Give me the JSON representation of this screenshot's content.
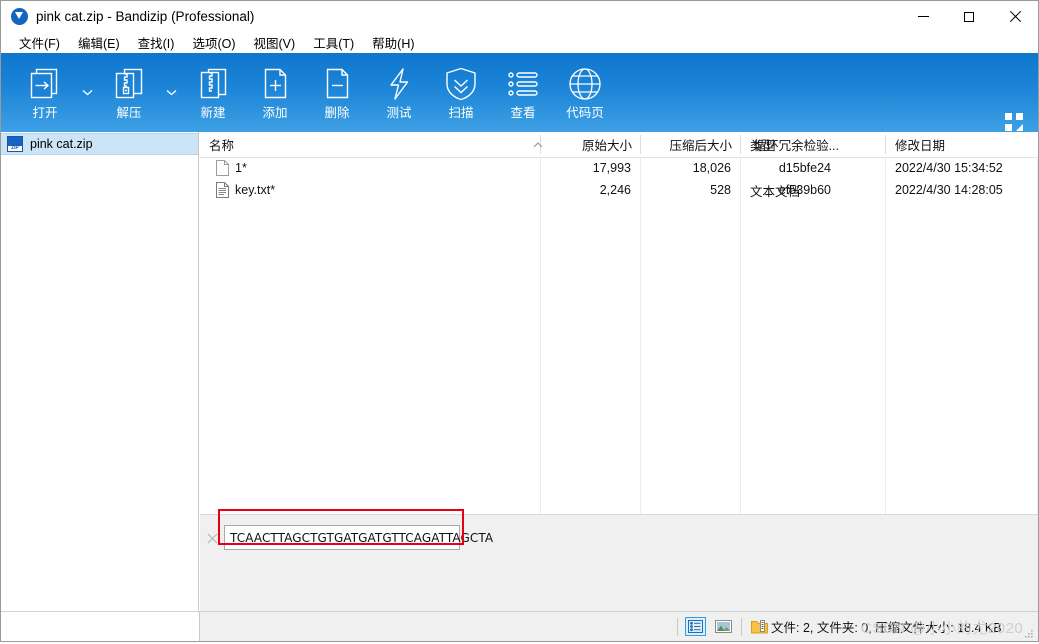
{
  "window": {
    "title": "pink cat.zip - Bandizip (Professional)",
    "app_icon": "bandizip-logo-icon",
    "controls": {
      "minimize": "minimize-icon",
      "maximize": "maximize-icon",
      "close": "close-icon"
    }
  },
  "menubar": {
    "items": [
      {
        "label": "文件(F)",
        "name": "menu-file"
      },
      {
        "label": "编辑(E)",
        "name": "menu-edit"
      },
      {
        "label": "查找(I)",
        "name": "menu-find"
      },
      {
        "label": "选项(O)",
        "name": "menu-options"
      },
      {
        "label": "视图(V)",
        "name": "menu-view"
      },
      {
        "label": "工具(T)",
        "name": "menu-tools"
      },
      {
        "label": "帮助(H)",
        "name": "menu-help"
      }
    ]
  },
  "toolbar": {
    "background_top": "#0e76cc",
    "background_bottom": "#3ea0e4",
    "buttons": [
      {
        "label": "打开",
        "icon": "open-archive-icon",
        "has_dropdown": true
      },
      {
        "label": "解压",
        "icon": "extract-icon",
        "has_dropdown": true
      },
      {
        "label": "新建",
        "icon": "new-archive-icon",
        "has_dropdown": false
      },
      {
        "label": "添加",
        "icon": "add-files-icon",
        "has_dropdown": false
      },
      {
        "label": "删除",
        "icon": "delete-files-icon",
        "has_dropdown": false
      },
      {
        "label": "测试",
        "icon": "test-archive-icon",
        "has_dropdown": false
      },
      {
        "label": "扫描",
        "icon": "virus-scan-shield-icon",
        "has_dropdown": false
      },
      {
        "label": "查看",
        "icon": "view-list-icon",
        "has_dropdown": false
      },
      {
        "label": "代码页",
        "icon": "codepage-globe-icon",
        "has_dropdown": false
      }
    ],
    "layout_button": "layout-grid-icon"
  },
  "sidebar": {
    "items": [
      {
        "label": "pink cat.zip",
        "icon": "zip-file-icon",
        "selected": true
      }
    ]
  },
  "filelist": {
    "sort_column": "名称",
    "sort_direction": "ascending",
    "columns": [
      {
        "label": "名称",
        "align": "left"
      },
      {
        "label": "原始大小",
        "align": "right"
      },
      {
        "label": "压缩后大小",
        "align": "right"
      },
      {
        "label": "循环冗余检验...",
        "align": "right"
      },
      {
        "label": "类型",
        "align": "left"
      },
      {
        "label": "修改日期",
        "align": "left"
      }
    ],
    "rows": [
      {
        "name": "1*",
        "icon": "blank-document-icon",
        "original_size": "17,993",
        "compressed_size": "18,026",
        "crc": "d15bfe24",
        "type": "",
        "modified": "2022/4/30 15:34:52"
      },
      {
        "name": "key.txt*",
        "icon": "text-document-icon",
        "original_size": "2,246",
        "compressed_size": "528",
        "crc": "ef539b60",
        "type": "文本文档",
        "modified": "2022/4/30 14:28:05"
      }
    ]
  },
  "comment_panel": {
    "close_icon": "close-comment-icon",
    "value": "TCAACTTAGCTGTGATGATGTTCAGATTAGCTA",
    "highlight_color": "#e60012"
  },
  "statusbar": {
    "view_icons": [
      {
        "name": "details-view-icon",
        "selected": true
      },
      {
        "name": "thumbnail-view-icon",
        "selected": false
      },
      {
        "name": "folder-view-icon",
        "selected": false
      }
    ],
    "text": "文件: 2, 文件夹: 0, 压缩文件大小: 18.4 KB",
    "watermark": "CSDN @小小的尤2020",
    "resize_grip": "resize-grip-icon"
  }
}
